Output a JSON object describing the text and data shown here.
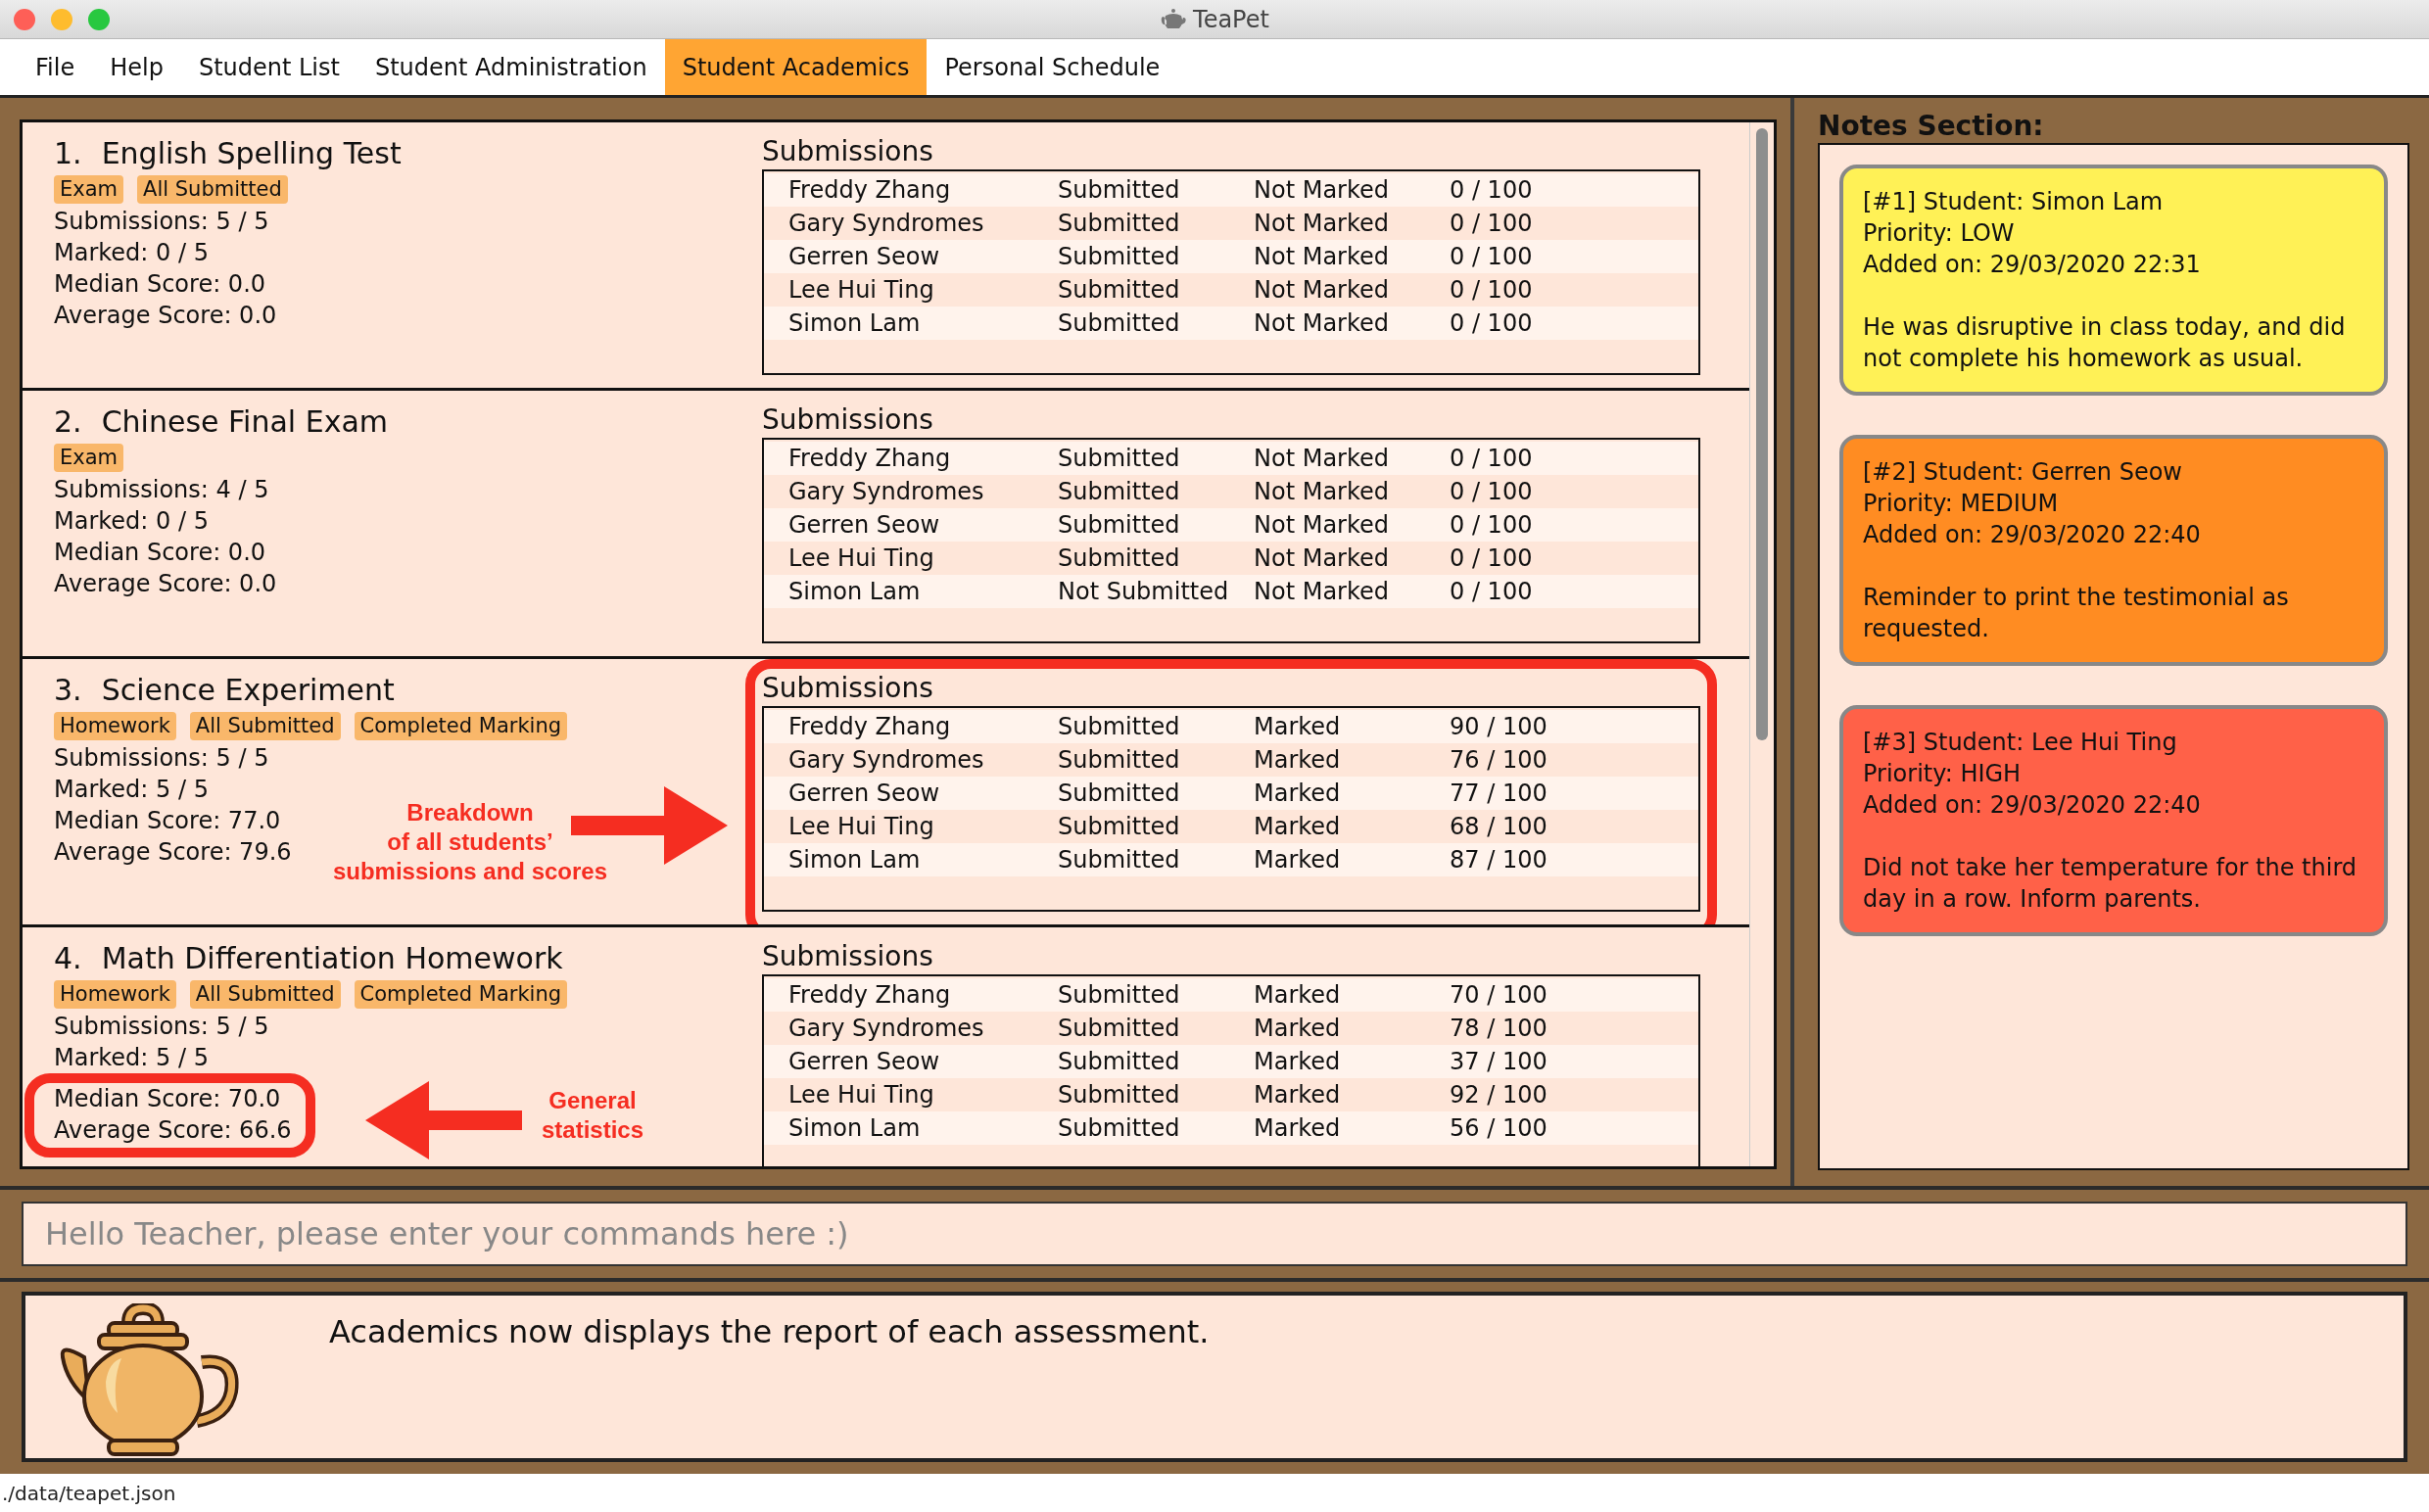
{
  "window": {
    "title": "TeaPet"
  },
  "menu": [
    {
      "label": "File",
      "selected": false
    },
    {
      "label": "Help",
      "selected": false
    },
    {
      "label": "Student List",
      "selected": false
    },
    {
      "label": "Student Administration",
      "selected": false
    },
    {
      "label": "Student Academics",
      "selected": true
    },
    {
      "label": "Personal Schedule",
      "selected": false
    }
  ],
  "assessments": [
    {
      "number": "1.",
      "title": "English Spelling Test",
      "tags": [
        "Exam",
        "All Submitted"
      ],
      "stats": [
        "Submissions: 5 / 5",
        "Marked: 0 / 5",
        "Median Score: 0.0",
        "Average Score: 0.0"
      ],
      "submissions_heading": "Submissions",
      "submissions": [
        {
          "student": "Freddy Zhang",
          "status": "Submitted",
          "marking": "Not Marked",
          "score": "0 / 100"
        },
        {
          "student": "Gary Syndromes",
          "status": "Submitted",
          "marking": "Not Marked",
          "score": "0 / 100"
        },
        {
          "student": "Gerren Seow",
          "status": "Submitted",
          "marking": "Not Marked",
          "score": "0 / 100"
        },
        {
          "student": "Lee Hui Ting",
          "status": "Submitted",
          "marking": "Not Marked",
          "score": "0 / 100"
        },
        {
          "student": "Simon Lam",
          "status": "Submitted",
          "marking": "Not Marked",
          "score": "0 / 100"
        }
      ]
    },
    {
      "number": "2.",
      "title": "Chinese Final Exam",
      "tags": [
        "Exam"
      ],
      "stats": [
        "Submissions: 4 / 5",
        "Marked: 0 / 5",
        "Median Score: 0.0",
        "Average Score: 0.0"
      ],
      "submissions_heading": "Submissions",
      "submissions": [
        {
          "student": "Freddy Zhang",
          "status": "Submitted",
          "marking": "Not Marked",
          "score": "0 / 100"
        },
        {
          "student": "Gary Syndromes",
          "status": "Submitted",
          "marking": "Not Marked",
          "score": "0 / 100"
        },
        {
          "student": "Gerren Seow",
          "status": "Submitted",
          "marking": "Not Marked",
          "score": "0 / 100"
        },
        {
          "student": "Lee Hui Ting",
          "status": "Submitted",
          "marking": "Not Marked",
          "score": "0 / 100"
        },
        {
          "student": "Simon Lam",
          "status": "Not Submitted",
          "marking": "Not Marked",
          "score": "0 / 100"
        }
      ]
    },
    {
      "number": "3.",
      "title": "Science Experiment",
      "tags": [
        "Homework",
        "All Submitted",
        "Completed Marking"
      ],
      "stats": [
        "Submissions: 5 / 5",
        "Marked: 5 / 5",
        "Median Score: 77.0",
        "Average Score: 79.6"
      ],
      "submissions_heading": "Submissions",
      "submissions": [
        {
          "student": "Freddy Zhang",
          "status": "Submitted",
          "marking": "Marked",
          "score": "90 / 100"
        },
        {
          "student": "Gary Syndromes",
          "status": "Submitted",
          "marking": "Marked",
          "score": "76 / 100"
        },
        {
          "student": "Gerren Seow",
          "status": "Submitted",
          "marking": "Marked",
          "score": "77 / 100"
        },
        {
          "student": "Lee Hui Ting",
          "status": "Submitted",
          "marking": "Marked",
          "score": "68 / 100"
        },
        {
          "student": "Simon Lam",
          "status": "Submitted",
          "marking": "Marked",
          "score": "87 / 100"
        }
      ],
      "annotation": {
        "kind": "table",
        "text": "Breakdown\nof all students’\nsubmissions and scores"
      }
    },
    {
      "number": "4.",
      "title": "Math Differentiation Homework",
      "tags": [
        "Homework",
        "All Submitted",
        "Completed Marking"
      ],
      "stats": [
        "Submissions: 5 / 5",
        "Marked: 5 / 5",
        "Median Score: 70.0",
        "Average Score: 66.6"
      ],
      "submissions_heading": "Submissions",
      "submissions": [
        {
          "student": "Freddy Zhang",
          "status": "Submitted",
          "marking": "Marked",
          "score": "70 / 100"
        },
        {
          "student": "Gary Syndromes",
          "status": "Submitted",
          "marking": "Marked",
          "score": "78 / 100"
        },
        {
          "student": "Gerren Seow",
          "status": "Submitted",
          "marking": "Marked",
          "score": "37 / 100"
        },
        {
          "student": "Lee Hui Ting",
          "status": "Submitted",
          "marking": "Marked",
          "score": "92 / 100"
        },
        {
          "student": "Simon Lam",
          "status": "Submitted",
          "marking": "Marked",
          "score": "56 / 100"
        }
      ],
      "annotation": {
        "kind": "stats",
        "text": "General\nstatistics"
      }
    }
  ],
  "notes_section": {
    "title": "Notes Section:",
    "notes": [
      {
        "header": "[#1] Student: Simon Lam",
        "priority": "Priority: LOW",
        "added": "Added on: 29/03/2020 22:31",
        "body": "He was disruptive in class today, and did not complete his homework as usual.",
        "color": "#fff156"
      },
      {
        "header": "[#2] Student: Gerren Seow",
        "priority": "Priority: MEDIUM",
        "added": "Added on: 29/03/2020 22:40",
        "body": "Reminder to print the testimonial as requested.",
        "color": "#ff8c22"
      },
      {
        "header": "[#3] Student: Lee Hui Ting",
        "priority": "Priority: HIGH",
        "added": "Added on: 29/03/2020 22:40",
        "body": "Did not take her temperature for the third day in a row. Inform parents.",
        "color": "#ff6148"
      }
    ]
  },
  "command_box": {
    "placeholder": "Hello Teacher, please enter your commands here :)"
  },
  "result_display": {
    "text": "Academics now displays the report of each assessment."
  },
  "status_bar": {
    "path": "./data/teapet.json"
  }
}
